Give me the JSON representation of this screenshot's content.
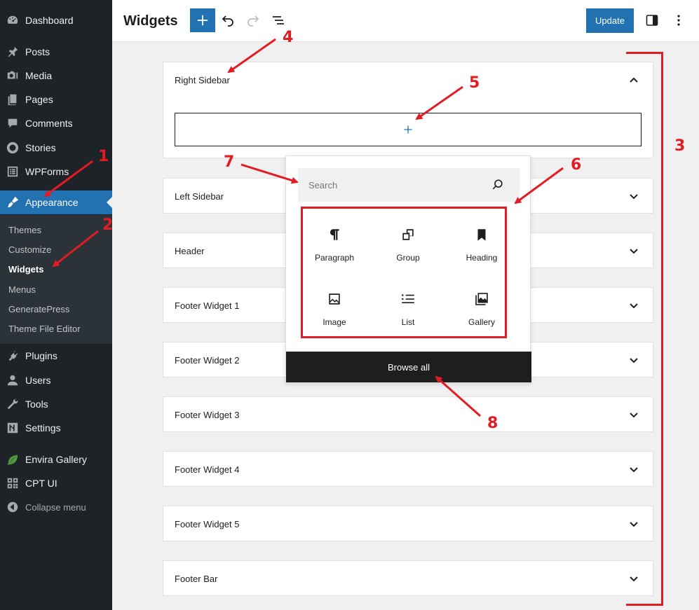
{
  "sidebar": {
    "items": [
      {
        "label": "Dashboard",
        "icon": "dashboard-icon"
      },
      {
        "label": "Posts",
        "icon": "pin-icon"
      },
      {
        "label": "Media",
        "icon": "media-icon"
      },
      {
        "label": "Pages",
        "icon": "pages-icon"
      },
      {
        "label": "Comments",
        "icon": "comment-icon"
      },
      {
        "label": "Stories",
        "icon": "stories-icon"
      },
      {
        "label": "WPForms",
        "icon": "forms-icon"
      },
      {
        "label": "Appearance",
        "icon": "brush-icon",
        "active": true
      },
      {
        "label": "Plugins",
        "icon": "plugin-icon"
      },
      {
        "label": "Users",
        "icon": "user-icon"
      },
      {
        "label": "Tools",
        "icon": "wrench-icon"
      },
      {
        "label": "Settings",
        "icon": "settings-icon"
      },
      {
        "label": "Envira Gallery",
        "icon": "leaf-icon"
      },
      {
        "label": "CPT UI",
        "icon": "grid-icon"
      },
      {
        "label": "Collapse menu",
        "icon": "collapse-icon"
      }
    ],
    "submenu": [
      "Themes",
      "Customize",
      "Widgets",
      "Menus",
      "GeneratePress",
      "Theme File Editor"
    ],
    "current_submenu": "Widgets"
  },
  "header": {
    "title": "Widgets",
    "update_label": "Update"
  },
  "areas": [
    "Right Sidebar",
    "Left Sidebar",
    "Header",
    "Footer Widget 1",
    "Footer Widget 2",
    "Footer Widget 3",
    "Footer Widget 4",
    "Footer Widget 5",
    "Footer Bar"
  ],
  "inserter": {
    "search_placeholder": "Search",
    "blocks": [
      "Paragraph",
      "Group",
      "Heading",
      "Image",
      "List",
      "Gallery"
    ],
    "browse_all": "Browse all"
  },
  "annotations": [
    "1",
    "2",
    "3",
    "4",
    "5",
    "6",
    "7",
    "8"
  ],
  "colors": {
    "sidebar_bg": "#1d2327",
    "accent": "#2271b1",
    "annotation_red": "#e31b23"
  }
}
